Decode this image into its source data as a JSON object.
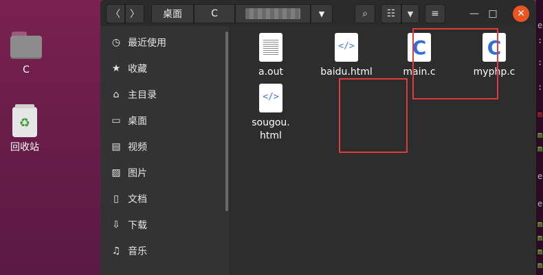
{
  "desktop": {
    "folder_label": "C",
    "trash_label": "回收站"
  },
  "header": {
    "breadcrumb_desktop": "桌面",
    "breadcrumb_c": "C"
  },
  "sidebar": {
    "items": [
      {
        "label": "最近使用",
        "icon": "clock-icon"
      },
      {
        "label": "收藏",
        "icon": "star-icon"
      },
      {
        "label": "主目录",
        "icon": "home-icon"
      },
      {
        "label": "桌面",
        "icon": "desktop-icon"
      },
      {
        "label": "视频",
        "icon": "video-icon"
      },
      {
        "label": "图片",
        "icon": "image-icon"
      },
      {
        "label": "文档",
        "icon": "document-icon"
      },
      {
        "label": "下载",
        "icon": "download-icon"
      },
      {
        "label": "音乐",
        "icon": "music-icon"
      }
    ]
  },
  "files": [
    {
      "name": "a.out",
      "type": "binary"
    },
    {
      "name": "baidu.html",
      "type": "html"
    },
    {
      "name": "main.c",
      "type": "c-source"
    },
    {
      "name": "myphp.c",
      "type": "c-source"
    },
    {
      "name": "sougou.\nhtml",
      "type": "html"
    }
  ],
  "icons": {
    "html_tag": "</>",
    "c_letter": "C"
  },
  "colors": {
    "accent": "#e95420",
    "highlight": "#e03c3c",
    "link_blue": "#3d7ad8"
  }
}
